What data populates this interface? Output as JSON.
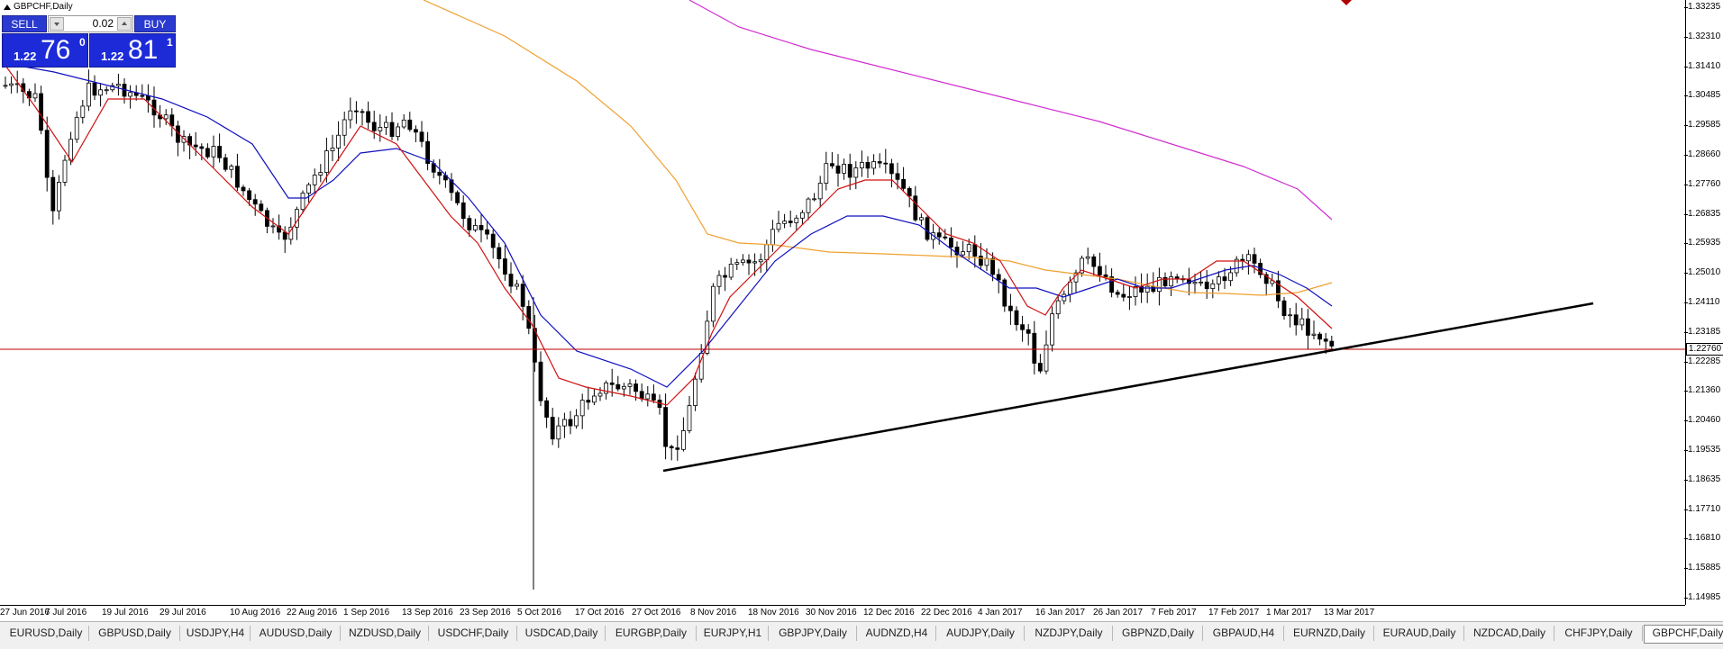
{
  "chart": {
    "title": "GBPCHF,Daily",
    "current_price": "1.22760",
    "price_ticks": [
      "1.33235",
      "1.32310",
      "1.31410",
      "1.30485",
      "1.29585",
      "1.28660",
      "1.27760",
      "1.26835",
      "1.25935",
      "1.25010",
      "1.24110",
      "1.23185",
      "1.22285",
      "1.21360",
      "1.20460",
      "1.19535",
      "1.18635",
      "1.17710",
      "1.16810",
      "1.15885",
      "1.14985"
    ],
    "date_ticks": [
      "27 Jun 2016",
      "7 Jul 2016",
      "19 Jul 2016",
      "29 Jul 2016",
      "10 Aug 2016",
      "22 Aug 2016",
      "1 Sep 2016",
      "13 Sep 2016",
      "23 Sep 2016",
      "5 Oct 2016",
      "17 Oct 2016",
      "27 Oct 2016",
      "8 Nov 2016",
      "18 Nov 2016",
      "30 Nov 2016",
      "12 Dec 2016",
      "22 Dec 2016",
      "4 Jan 2017",
      "16 Jan 2017",
      "26 Jan 2017",
      "7 Feb 2017",
      "17 Feb 2017",
      "1 Mar 2017",
      "13 Mar 2017"
    ],
    "colors": {
      "ma_fast": "#d01010",
      "ma_mid": "#1010c0",
      "ma_slow": "#f0a030",
      "ma_long": "#d030d0",
      "price_line": "#c00000",
      "trendline": "#000000"
    }
  },
  "trade_panel": {
    "sell_label": "SELL",
    "buy_label": "BUY",
    "lot_size": "0.02",
    "bid": {
      "prefix": "1.22",
      "big": "76",
      "sup": "0"
    },
    "ask": {
      "prefix": "1.22",
      "big": "81",
      "sup": "1"
    }
  },
  "tabs": [
    "EURUSD,Daily",
    "GBPUSD,Daily",
    "USDJPY,H4",
    "AUDUSD,Daily",
    "NZDUSD,Daily",
    "USDCHF,Daily",
    "USDCAD,Daily",
    "EURGBP,Daily",
    "EURJPY,H1",
    "GBPJPY,Daily",
    "AUDNZD,H4",
    "AUDJPY,Daily",
    "NZDJPY,Daily",
    "GBPNZD,Daily",
    "GBPAUD,H4",
    "EURNZD,Daily",
    "EURAUD,Daily",
    "NZDCAD,Daily",
    "CHFJPY,Daily",
    "GBPCHF,Daily"
  ],
  "active_tab": "GBPCHF,Daily"
}
